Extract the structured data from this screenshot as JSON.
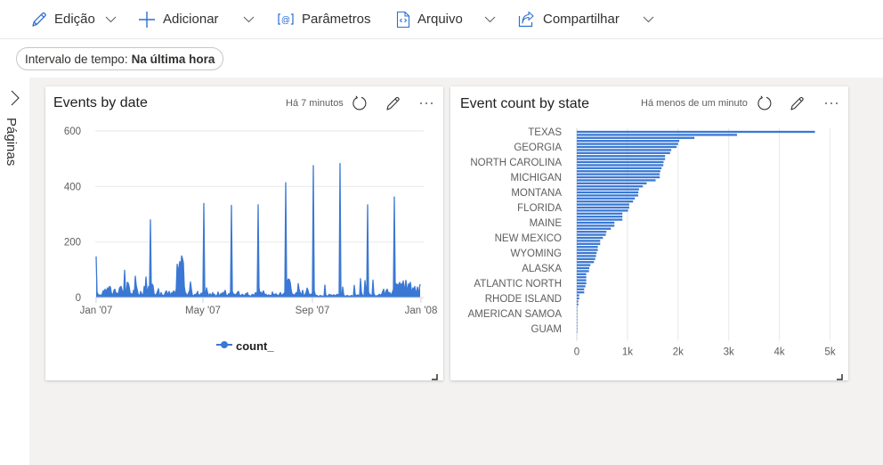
{
  "toolbar": {
    "items": [
      {
        "label": "Edição",
        "icon": "pencil-icon",
        "has_dropdown": true
      },
      {
        "label": "Adicionar",
        "icon": "plus-icon",
        "has_dropdown": true
      },
      {
        "label": "Parâmetros",
        "icon": "parameters-icon",
        "has_dropdown": false
      },
      {
        "label": "Arquivo",
        "icon": "file-code-icon",
        "has_dropdown": true
      },
      {
        "label": "Compartilhar",
        "icon": "share-icon",
        "has_dropdown": true
      }
    ]
  },
  "filter": {
    "label": "Intervalo de tempo:",
    "value": "Na última hora"
  },
  "sidebar": {
    "label": "Páginas",
    "toggle_icon": "chevron-right-icon"
  },
  "colors": {
    "accent": "#3a78d4",
    "canvas_bg": "#f3f2f1",
    "grid": "#ebebeb",
    "muted_text": "#605e5c"
  },
  "tiles": [
    {
      "title": "Events by date",
      "last_refresh": "Há 7 minutos",
      "actions": [
        "refresh-icon",
        "pencil-icon",
        "more-icon"
      ]
    },
    {
      "title": "Event count by state",
      "last_refresh": "Há menos de um minuto",
      "actions": [
        "refresh-icon",
        "pencil-icon",
        "more-icon"
      ]
    }
  ],
  "chart_data": [
    {
      "type": "area",
      "title": "Events by date",
      "xlabel": "",
      "ylabel": "",
      "x_start": "2007-01-01",
      "x_interval": "1 day",
      "ylim": [
        0,
        600
      ],
      "yticks": [
        0,
        200,
        400,
        600
      ],
      "xticks": [
        {
          "label": "Jan '07",
          "date": "2007-01-01"
        },
        {
          "label": "May '07",
          "date": "2007-05-01"
        },
        {
          "label": "Sep '07",
          "date": "2007-09-01"
        },
        {
          "label": "Jan '08",
          "date": "2008-01-01"
        }
      ],
      "grid": true,
      "legend": {
        "position": "bottom",
        "entries": [
          "count_"
        ]
      },
      "series": [
        {
          "name": "count_",
          "values": [
            148,
            20,
            12,
            8,
            10,
            6,
            9,
            14,
            25,
            18,
            30,
            22,
            28,
            35,
            30,
            40,
            38,
            18,
            12,
            10,
            26,
            30,
            18,
            14,
            16,
            8,
            32,
            38,
            40,
            28,
            20,
            22,
            98,
            30,
            12,
            55,
            52,
            40,
            20,
            10,
            14,
            8,
            26,
            18,
            77,
            45,
            30,
            15,
            8,
            6,
            22,
            14,
            10,
            12,
            40,
            20,
            74,
            30,
            22,
            40,
            30,
            280,
            20,
            48,
            42,
            15,
            10,
            8,
            14,
            22,
            32,
            12,
            6,
            18,
            10,
            8,
            5,
            12,
            20,
            24,
            10,
            16,
            22,
            14,
            6,
            18,
            12,
            24,
            20,
            14,
            30,
            120,
            90,
            110,
            130,
            100,
            150,
            140,
            125,
            40,
            20,
            14,
            10,
            8,
            18,
            25,
            56,
            30,
            10,
            6,
            8,
            12,
            10,
            14,
            22,
            6,
            10,
            8,
            16,
            12,
            20,
            339,
            25,
            12,
            35,
            20,
            10,
            8,
            14,
            6,
            10,
            18,
            8,
            12,
            6,
            5,
            9,
            20,
            8,
            6,
            14,
            10,
            18,
            12,
            20,
            26,
            10,
            8,
            6,
            14,
            12,
            20,
            332,
            22,
            14,
            10,
            12,
            8,
            14,
            20,
            22,
            10,
            8,
            6,
            12,
            10,
            6,
            8,
            14,
            12,
            18,
            6,
            8,
            4,
            6,
            10,
            12,
            6,
            10,
            18,
            12,
            20,
            334,
            35,
            14,
            20,
            10,
            18,
            24,
            14,
            8,
            12,
            6,
            8,
            10,
            6,
            8,
            6,
            20,
            10,
            12,
            8,
            14,
            10,
            6,
            8,
            12,
            18,
            10,
            8,
            12,
            14,
            20,
            414,
            40,
            60,
            67,
            65,
            55,
            30,
            14,
            12,
            10,
            8,
            14,
            18,
            12,
            50,
            30,
            20,
            10,
            14,
            26,
            10,
            6,
            12,
            20,
            34,
            26,
            14,
            10,
            12,
            8,
            20,
            475,
            25,
            12,
            6,
            8,
            5,
            4,
            6,
            8,
            4,
            6,
            5,
            4,
            45,
            10,
            6,
            4,
            8,
            12,
            8,
            10,
            6,
            8,
            10,
            8,
            6,
            10,
            12,
            8,
            12,
            483,
            14,
            8,
            38,
            12,
            6,
            4,
            6,
            8,
            5,
            6,
            4,
            6,
            8,
            4,
            6,
            44,
            12,
            6,
            8,
            10,
            6,
            8,
            68,
            20,
            10,
            6,
            8,
            61,
            30,
            10,
            334,
            20,
            12,
            10,
            8,
            6,
            63,
            14,
            8,
            6,
            4,
            8,
            6,
            12,
            10,
            8,
            14,
            22,
            30,
            16,
            12,
            26,
            30,
            20,
            14,
            18,
            10,
            12,
            20,
            30,
            362,
            45,
            50,
            40,
            48,
            42,
            55,
            38,
            50,
            45,
            60,
            30,
            40,
            62,
            35,
            28,
            50,
            40,
            55,
            30,
            20,
            35,
            28,
            40,
            15,
            22,
            38,
            10,
            30,
            48
          ]
        }
      ]
    },
    {
      "type": "bar",
      "orientation": "horizontal",
      "title": "Event count by state",
      "xlabel": "",
      "ylabel": "",
      "xlim": [
        0,
        5000
      ],
      "xticks": [
        {
          "value": 0,
          "label": "0"
        },
        {
          "value": 1000,
          "label": "1k"
        },
        {
          "value": 2000,
          "label": "2k"
        },
        {
          "value": 3000,
          "label": "3k"
        },
        {
          "value": 4000,
          "label": "4k"
        },
        {
          "value": 5000,
          "label": "5k"
        }
      ],
      "grid": true,
      "category_tick_labels": [
        {
          "category_index": 0,
          "label": "TEXAS"
        },
        {
          "category_index": 5,
          "label": "GEORGIA"
        },
        {
          "category_index": 10,
          "label": "NORTH CAROLINA"
        },
        {
          "category_index": 15,
          "label": "MICHIGAN"
        },
        {
          "category_index": 20,
          "label": "MONTANA"
        },
        {
          "category_index": 25,
          "label": "FLORIDA"
        },
        {
          "category_index": 30,
          "label": "MAINE"
        },
        {
          "category_index": 35,
          "label": "NEW MEXICO"
        },
        {
          "category_index": 40,
          "label": "WYOMING"
        },
        {
          "category_index": 45,
          "label": "ALASKA"
        },
        {
          "category_index": 50,
          "label": "ATLANTIC NORTH"
        },
        {
          "category_index": 55,
          "label": "RHODE ISLAND"
        },
        {
          "category_index": 60,
          "label": "AMERICAN SAMOA"
        },
        {
          "category_index": 65,
          "label": "GUAM"
        }
      ],
      "values": [
        4702,
        3164,
        2322,
        2023,
        2000,
        1971,
        1865,
        1842,
        1743,
        1743,
        1713,
        1708,
        1673,
        1649,
        1637,
        1637,
        1556,
        1380,
        1304,
        1228,
        1216,
        1211,
        1146,
        1111,
        1035,
        1035,
        1012,
        900,
        900,
        900,
        743,
        743,
        672,
        585,
        573,
        515,
        462,
        462,
        415,
        415,
        392,
        380,
        363,
        339,
        269,
        246,
        240,
        187,
        187,
        187,
        187,
        170,
        146,
        146,
        47,
        47,
        29,
        29,
        6,
        4,
        3,
        2,
        1,
        1,
        1,
        1,
        1
      ]
    }
  ]
}
